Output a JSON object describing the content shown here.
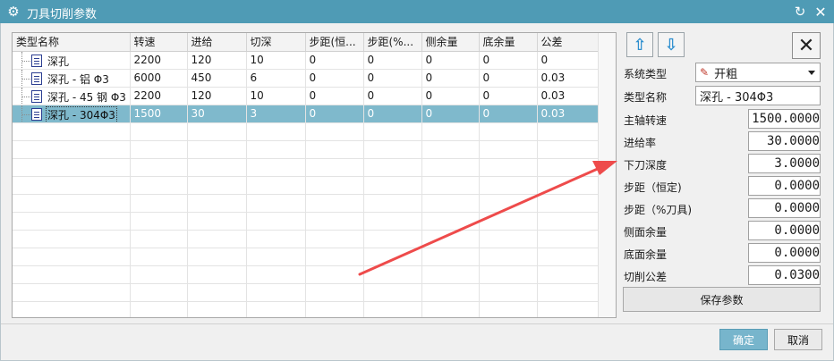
{
  "window": {
    "title": "刀具切削参数"
  },
  "table": {
    "columns": [
      "类型名称",
      "转速",
      "进给",
      "切深",
      "步距(恒...",
      "步距(%...",
      "侧余量",
      "底余量",
      "公差"
    ],
    "rows": [
      [
        "深孔",
        "2200",
        "120",
        "10",
        "0",
        "0",
        "0",
        "0",
        "0"
      ],
      [
        "深孔 - 铝 Φ3",
        "6000",
        "450",
        "6",
        "0",
        "0",
        "0",
        "0",
        "0.03"
      ],
      [
        "深孔 - 45 钢 Φ3",
        "2200",
        "120",
        "10",
        "0",
        "0",
        "0",
        "0",
        "0.03"
      ],
      [
        "深孔 - 304Φ3",
        "1500",
        "30",
        "3",
        "0",
        "0",
        "0",
        "0",
        "0.03"
      ]
    ],
    "selected_row": 3
  },
  "props": {
    "system_type_label": "系统类型",
    "system_type_value": "开粗",
    "type_name_label": "类型名称",
    "type_name_value": "深孔 - 304Φ3",
    "spindle_label": "主轴转速",
    "spindle_value": "1500.0000",
    "feed_label": "进给率",
    "feed_value": "30.0000",
    "depth_label": "下刀深度",
    "depth_value": "3.0000",
    "step_const_label": "步距（恒定)",
    "step_const_value": "0.0000",
    "step_pct_label": "步距（%刀具)",
    "step_pct_value": "0.0000",
    "side_stock_label": "侧面余量",
    "side_stock_value": "0.0000",
    "floor_stock_label": "底面余量",
    "floor_stock_value": "0.0000",
    "tolerance_label": "切削公差",
    "tolerance_value": "0.0300",
    "save_label": "保存参数"
  },
  "footer": {
    "ok_label": "确定",
    "cancel_label": "取消"
  },
  "colors": {
    "titlebar": "#4f9bb5",
    "selection": "#7fb9cc",
    "annotation_arrow": "#ee4b4b",
    "arrow_button": "#2e8fcf"
  }
}
